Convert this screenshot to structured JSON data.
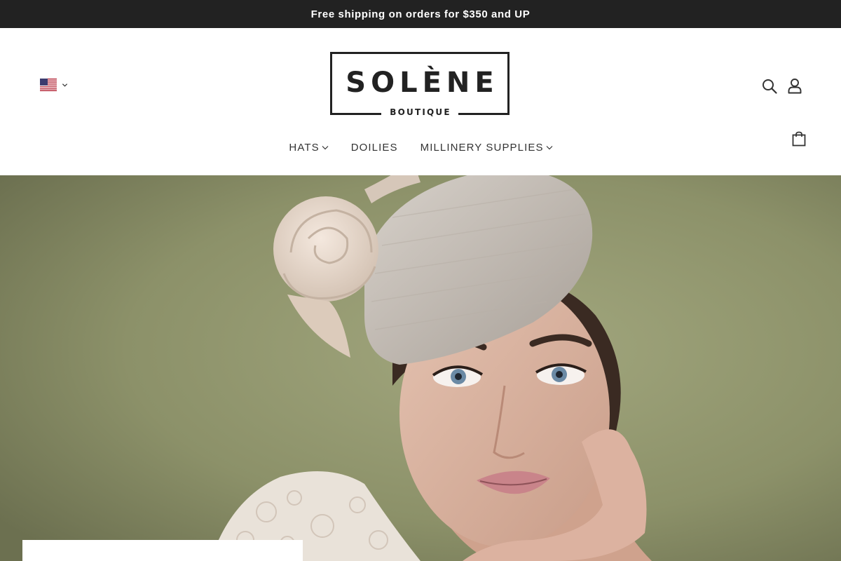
{
  "announcement": {
    "text": "Free shipping on orders for $350 and UP"
  },
  "header": {
    "currency_flag": "us-flag-icon",
    "logo": {
      "main": "SOLÈNE",
      "sub": "BOUTIQUE"
    },
    "icons": {
      "search": "search-icon",
      "account": "account-icon",
      "cart": "shopping-bag-icon"
    }
  },
  "nav": {
    "items": [
      {
        "label": "HATS",
        "has_dropdown": true
      },
      {
        "label": "DOILIES",
        "has_dropdown": false
      },
      {
        "label": "MILLINERY SUPPLIES",
        "has_dropdown": true
      }
    ]
  },
  "hero": {
    "image": "woman wearing cream pillbox fascinator with large rose, lace top, olive green background",
    "colors": {
      "background": "#8a9068",
      "hat": "#c9c1b8",
      "skin": "#d9b3a0"
    }
  },
  "colors": {
    "announcement_bg": "#222222",
    "text": "#333333",
    "logo": "#222222"
  }
}
